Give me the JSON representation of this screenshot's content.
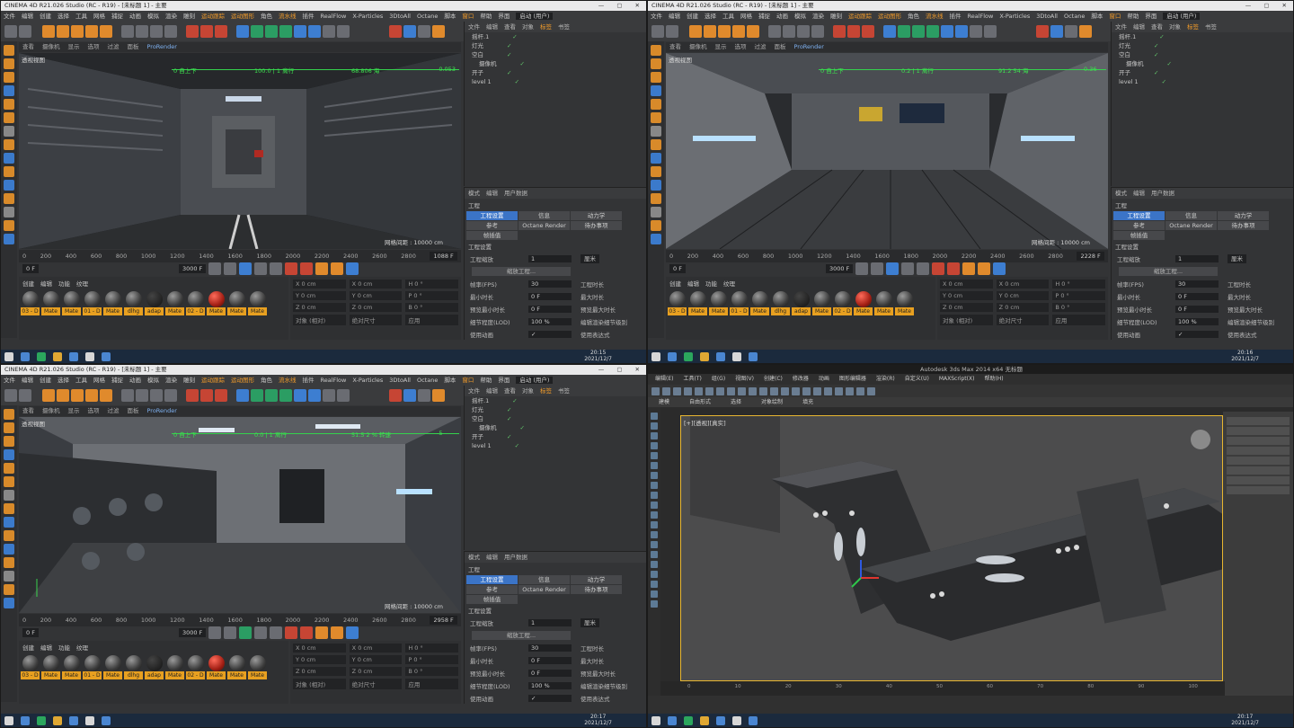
{
  "c4d_window_title": "CINEMA 4D R21.026 Studio (RC - R19) - [未标题 1] - 主要",
  "c4d_menu": [
    "文件",
    "编辑",
    "创建",
    "选择",
    "工具",
    "网格",
    "捕捉",
    "动画",
    "模拟",
    "渲染",
    "雕刻",
    "运动跟踪",
    "运动图形",
    "角色",
    "流水线",
    "插件",
    "RealFlow",
    "X-Particles",
    "3DtoAll",
    "Octane",
    "脚本",
    "窗口",
    "帮助"
  ],
  "c4d_menu_highlight": [
    "运动跟踪",
    "运动图形",
    "流水线",
    "窗口"
  ],
  "c4d_interface_label": "界面",
  "c4d_interface_value": "启动 (用户)",
  "viewport_menu": [
    "查看",
    "摄像机",
    "显示",
    "选项",
    "过滤",
    "面板"
  ],
  "viewport_prorender": "ProRender",
  "viewport_label": "透视视图",
  "grid_spacing": "网格间距 : 10000 cm",
  "ruler": [
    "0",
    "200",
    "400",
    "600",
    "800",
    "1000",
    "1200",
    "1400",
    "1600",
    "1800",
    "2000",
    "2200",
    "2400",
    "2600",
    "2800"
  ],
  "frame_start": "0 F",
  "frame_end": "3000 F",
  "frame_current_values": [
    "1088 F",
    "2228 F",
    "2958 F"
  ],
  "material_tabs": [
    "创建",
    "编辑",
    "功能",
    "纹理"
  ],
  "materials": [
    "03 - D",
    "Mate",
    "Mate",
    "01 - D",
    "Mate",
    "dlhg",
    "adap",
    "Mate",
    "02 - D",
    "Mate",
    "Mate",
    "Mate"
  ],
  "coord_rows": [
    [
      "X  0 cm",
      "X  0 cm",
      "H  0 °"
    ],
    [
      "Y  0 cm",
      "Y  0 cm",
      "P  0 °"
    ],
    [
      "Z  0 cm",
      "Z  0 cm",
      "B  0 °"
    ]
  ],
  "coord_mode": "对象 (相对)",
  "coord_size": "绝对尺寸",
  "coord_apply": "应用",
  "object_tabs": [
    "文件",
    "编辑",
    "查看",
    "对象",
    "标签",
    "书签"
  ],
  "objects": [
    "摇杆.1",
    "灯光",
    "空白",
    "摄像机",
    "开子",
    "level 1"
  ],
  "attr_tabs": [
    "模式",
    "编辑",
    "用户数据"
  ],
  "attr_section": "工程",
  "attr_grid": [
    "工程设置",
    "信息",
    "动力学",
    "参考",
    "Octane Render",
    "待办事项",
    "帧插值"
  ],
  "attr_heading": "工程设置",
  "project_scale_label": "工程缩放",
  "project_scale_value": "1",
  "project_scale_unit": "厘米",
  "scale_button": "缩放工程...",
  "fps_label": "帧率(FPS)",
  "fps_value": "30",
  "min_time_label": "最小时长",
  "min_time_value": "0 F",
  "preview_min_label": "预览最小时长",
  "preview_min_value": "0 F",
  "lod_label": "细节程度(LOD)",
  "lod_value": "100 %",
  "use_anim_label": "使用动画",
  "project_time_label": "工程时长",
  "max_time_label": "最大时长",
  "preview_max_label": "预览最大时长",
  "render_lod_label": "编辑渲染细节级别",
  "use_expr_label": "使用表达式",
  "hud_values": [
    [
      "0 自上下",
      "100.0 | 1 离行",
      "68.806 海",
      "-0.053"
    ],
    [
      "0 自上下",
      "0.2 | 1 离行",
      "91.2 54 海",
      "0.36"
    ],
    [
      "0 自上下",
      "0.0 | 1 离行",
      "51.5 2 % 转速",
      "-5"
    ]
  ],
  "clock_times": [
    "20:15",
    "20:16",
    "20:17"
  ],
  "clock_date": "2021/12/7",
  "max_window_title": "Autodesk 3ds Max 2014 x64    无标题",
  "max_menu": [
    "编辑(E)",
    "工具(T)",
    "组(G)",
    "视图(V)",
    "创建(C)",
    "修改器",
    "动画",
    "图形编辑器",
    "渲染(R)",
    "自定义(U)",
    "MAXScript(X)",
    "帮助(H)"
  ],
  "max_ribbon": [
    "建模",
    "自由形式",
    "选择",
    "对象绘制",
    "填充"
  ],
  "max_viewport_label": "[+][透视][真实]",
  "max_timeline": [
    "0",
    "10",
    "20",
    "30",
    "40",
    "50",
    "60",
    "70",
    "80",
    "90",
    "100"
  ],
  "colors": {
    "accent_orange": "#e8a020",
    "c4d_blue": "#3b74c7",
    "hud_green": "#3de24f",
    "max_select": "#e8b630"
  }
}
